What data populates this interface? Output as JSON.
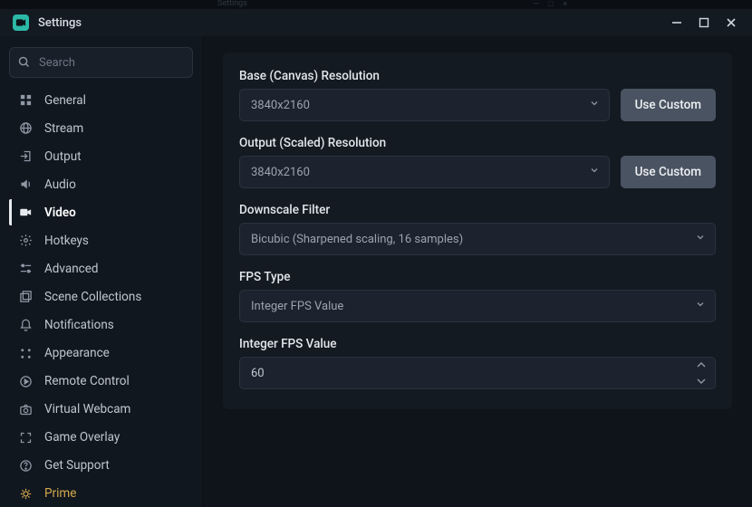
{
  "window": {
    "title": "Settings",
    "ghost_title": "Settings"
  },
  "search": {
    "placeholder": "Search"
  },
  "sidebar": {
    "items": [
      {
        "label": "General"
      },
      {
        "label": "Stream"
      },
      {
        "label": "Output"
      },
      {
        "label": "Audio"
      },
      {
        "label": "Video"
      },
      {
        "label": "Hotkeys"
      },
      {
        "label": "Advanced"
      },
      {
        "label": "Scene Collections"
      },
      {
        "label": "Notifications"
      },
      {
        "label": "Appearance"
      },
      {
        "label": "Remote Control"
      },
      {
        "label": "Virtual Webcam"
      },
      {
        "label": "Game Overlay"
      },
      {
        "label": "Get Support"
      },
      {
        "label": "Prime"
      }
    ],
    "active_index": 4
  },
  "video": {
    "base_res": {
      "label": "Base (Canvas) Resolution",
      "value": "3840x2160",
      "custom_btn": "Use Custom"
    },
    "output_res": {
      "label": "Output (Scaled) Resolution",
      "value": "3840x2160",
      "custom_btn": "Use Custom"
    },
    "downscale": {
      "label": "Downscale Filter",
      "value": "Bicubic (Sharpened scaling, 16 samples)"
    },
    "fps_type": {
      "label": "FPS Type",
      "value": "Integer FPS Value"
    },
    "fps_value": {
      "label": "Integer FPS Value",
      "value": "60"
    }
  }
}
